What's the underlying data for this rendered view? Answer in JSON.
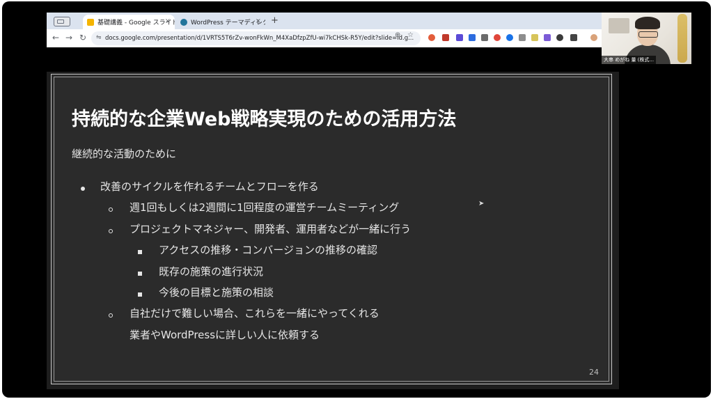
{
  "browser": {
    "tabs": [
      {
        "label": "基礎講義 - Google スライド",
        "close": "×",
        "favicon_color": "#f4b400",
        "active": true
      },
      {
        "label": "WordPress テーマディレクトリ",
        "close": "×",
        "favicon_color": "#21759b",
        "active": false
      }
    ],
    "new_tab": "+",
    "url": "docs.google.com/presentation/d/1VRTS5T6rZv-wonFkWn_M4XaDfzpZfU-wi7kCHSk-R5Y/edit?slide=id.g...",
    "icons": [
      "back-icon",
      "forward-icon",
      "reload-icon",
      "site-info-icon",
      "zoom-icon",
      "bookmark-star-icon",
      "extensions-icon",
      "profile-avatar"
    ],
    "glyphs": {
      "back": "←",
      "forward": "→",
      "reload": "↻",
      "site_info": "⇋",
      "zoom": "⊕",
      "star": "☆"
    }
  },
  "webcam": {
    "name_label": "大串 めがね 量 (株式..."
  },
  "slide": {
    "title": "持続的な企業Web戦略実現のための活用方法",
    "subtitle": "継続的な活動のために",
    "bullets": [
      {
        "level": 1,
        "marker": "disc",
        "text": "改善のサイクルを作れるチームとフローを作る"
      },
      {
        "level": 2,
        "marker": "circle",
        "text": "週1回もしくは2週間に1回程度の運営チームミーティング"
      },
      {
        "level": 2,
        "marker": "circle",
        "text": "プロジェクトマネジャー、開発者、運用者などが一緒に行う"
      },
      {
        "level": 3,
        "marker": "square",
        "text": "アクセスの推移・コンバージョンの推移の確認"
      },
      {
        "level": 3,
        "marker": "square",
        "text": "既存の施策の進行状況"
      },
      {
        "level": 3,
        "marker": "square",
        "text": "今後の目標と施策の相談"
      },
      {
        "level": 2,
        "marker": "circle",
        "text": "自社だけで難しい場合、これらを一緒にやってくれる"
      },
      {
        "level": 2,
        "marker": "none",
        "text": "業者やWordPressに詳しい人に依頼する"
      }
    ],
    "page_number": "24"
  },
  "colors": {
    "slide_bg": "#2b2b2b",
    "text": "#e6e6e6",
    "title": "#ffffff",
    "frame": "#000000"
  }
}
